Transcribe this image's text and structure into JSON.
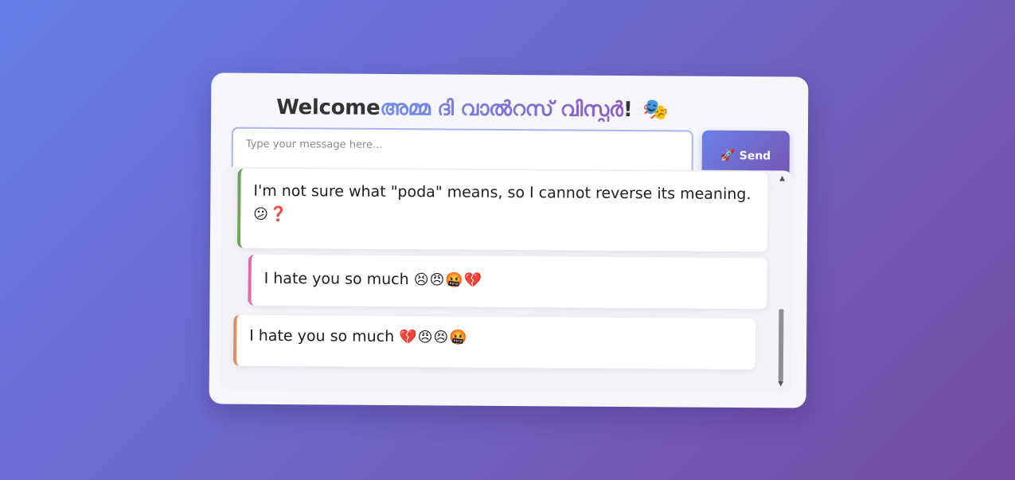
{
  "header": {
    "welcome": "Welcome",
    "name": "അമ്മ ദി വാൽറസ് വിസ്പർ",
    "exclaim": "!",
    "masks": "🎭"
  },
  "composer": {
    "placeholder": "Type your message here...",
    "send_icon": "🚀",
    "send_label": "Send"
  },
  "messages": [
    {
      "text": "I'm not sure what \"poda\" means, so I cannot reverse its meaning.",
      "emojis": "😕❓",
      "accent": "#6aa84f"
    },
    {
      "text": "I hate you so much",
      "emojis": "😣😠🤬💔",
      "accent": "#e06aa8"
    },
    {
      "text": "I hate you so much",
      "emojis": "💔😠😣🤬",
      "accent": "#e68a60"
    }
  ],
  "colors": {
    "bg_start": "#667eea",
    "bg_end": "#764ba2"
  }
}
